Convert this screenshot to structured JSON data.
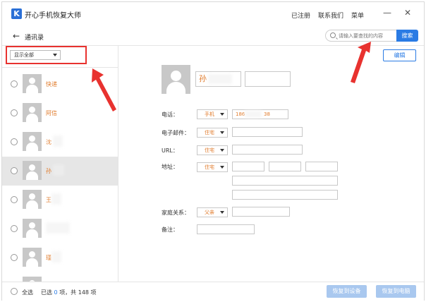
{
  "app": {
    "logo_letter": "K",
    "title": "开心手机恢复大师",
    "links": [
      "已注册",
      "联系我们",
      "菜单"
    ],
    "minimize": "—",
    "close": "✕"
  },
  "nav": {
    "back": "←",
    "title": "通讯录",
    "search_placeholder": "请输入要查找的内容",
    "search_button": "搜索"
  },
  "filter": {
    "selected": "显示全部"
  },
  "contacts": [
    {
      "name": "快递",
      "selected": false
    },
    {
      "name": "阿信",
      "selected": false
    },
    {
      "name": "沈",
      "selected": false
    },
    {
      "name": "孙",
      "selected": true
    },
    {
      "name": "王",
      "selected": false
    },
    {
      "name": "",
      "selected": false
    },
    {
      "name": "瑾",
      "selected": false
    }
  ],
  "footer": {
    "select_all": "全选",
    "selected_prefix": "已选",
    "selected_count": "0",
    "selected_suffix": "项，共 148 项",
    "restore_device": "恢复到设备",
    "restore_pc": "恢复到电脑"
  },
  "detail": {
    "edit": "编辑",
    "name_first": "孙",
    "labels": {
      "phone": "电话：",
      "email": "电子邮件：",
      "url": "URL：",
      "address": "地址：",
      "family": "家庭关系：",
      "note": "备注："
    },
    "phone_type": "手机",
    "phone_value": "186",
    "phone_tail": "38",
    "email_type": "住宅",
    "url_type": "住宅",
    "address_type": "住宅",
    "family_type": "父亲"
  },
  "colors": {
    "accent": "#2a7be4",
    "highlight_text": "#e07a2a",
    "annotation_red": "#e8322f",
    "disabled_button": "#a9c8ef"
  }
}
